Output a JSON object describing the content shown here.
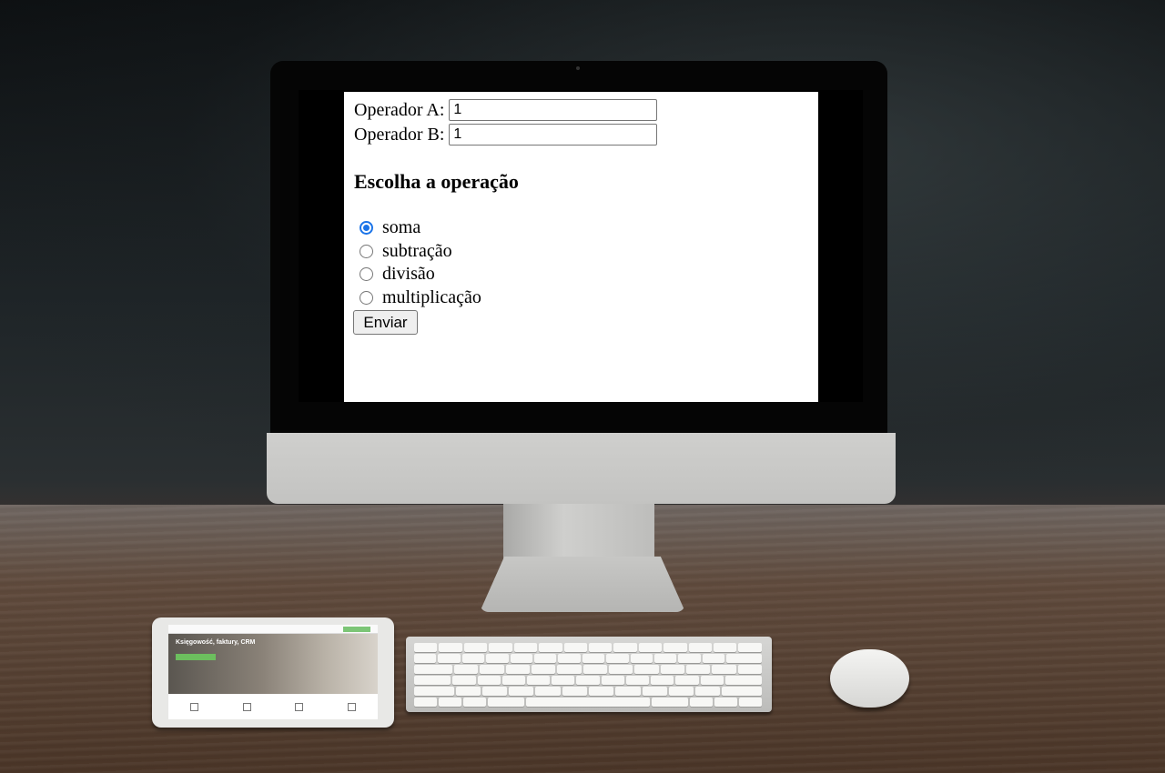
{
  "form": {
    "field_a": {
      "label": "Operador A:",
      "value": "1"
    },
    "field_b": {
      "label": "Operador B:",
      "value": "1"
    },
    "heading": "Escolha a operação",
    "operations": [
      {
        "label": "soma",
        "checked": true
      },
      {
        "label": "subtração",
        "checked": false
      },
      {
        "label": "divisão",
        "checked": false
      },
      {
        "label": "multiplicação",
        "checked": false
      }
    ],
    "submit_label": "Enviar"
  },
  "tablet": {
    "hero_title": "Księgowość, faktury, CRM"
  },
  "colors": {
    "radio_accent": "#1a73e8",
    "page_background": "#ffffff",
    "tablet_cta": "#6cbf5e"
  }
}
